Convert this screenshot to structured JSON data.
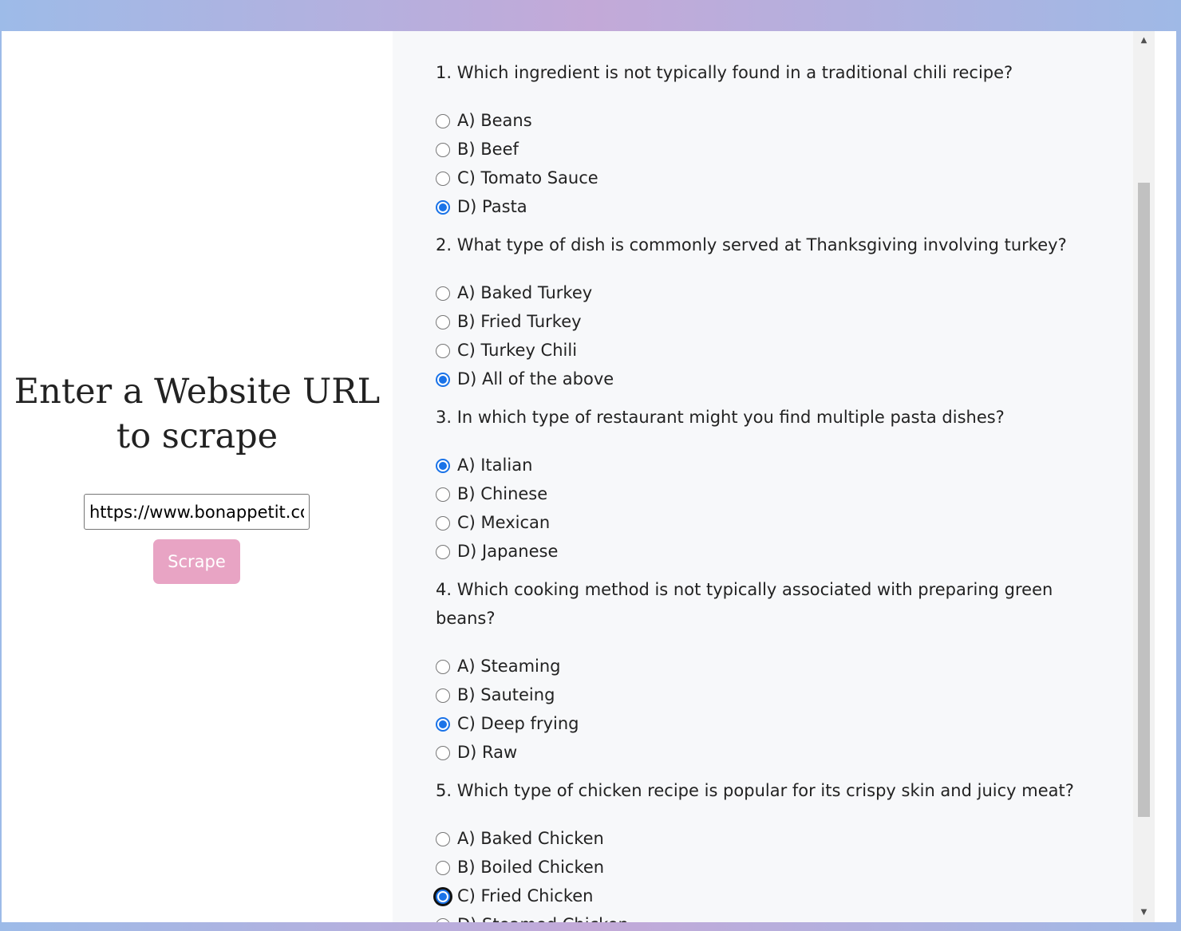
{
  "left": {
    "heading": "Enter a Website URL to scrape",
    "url_value": "https://www.bonappetit.com",
    "scrape_label": "Scrape"
  },
  "quiz": [
    {
      "question": "1. Which ingredient is not typically found in a traditional chili recipe?",
      "options": [
        "A) Beans",
        "B) Beef",
        "C) Tomato Sauce",
        "D) Pasta"
      ],
      "selected": 3
    },
    {
      "question": "2. What type of dish is commonly served at Thanksgiving involving turkey?",
      "options": [
        "A) Baked Turkey",
        "B) Fried Turkey",
        "C) Turkey Chili",
        "D) All of the above"
      ],
      "selected": 3
    },
    {
      "question": "3. In which type of restaurant might you find multiple pasta dishes?",
      "options": [
        "A) Italian",
        "B) Chinese",
        "C) Mexican",
        "D) Japanese"
      ],
      "selected": 0
    },
    {
      "question": "4. Which cooking method is not typically associated with preparing green beans?",
      "options": [
        "A) Steaming",
        "B) Sauteing",
        "C) Deep frying",
        "D) Raw"
      ],
      "selected": 2
    },
    {
      "question": "5. Which type of chicken recipe is popular for its crispy skin and juicy meat?",
      "options": [
        "A) Baked Chicken",
        "B) Boiled Chicken",
        "C) Fried Chicken",
        "D) Steamed Chicken"
      ],
      "selected": 2
    }
  ],
  "scrollbar": {
    "up_icon": "▲",
    "down_icon": "▼"
  },
  "colors": {
    "accent": "#1a73e8",
    "button": "#e8a4c4",
    "panel_bg": "#f7f8fa"
  }
}
